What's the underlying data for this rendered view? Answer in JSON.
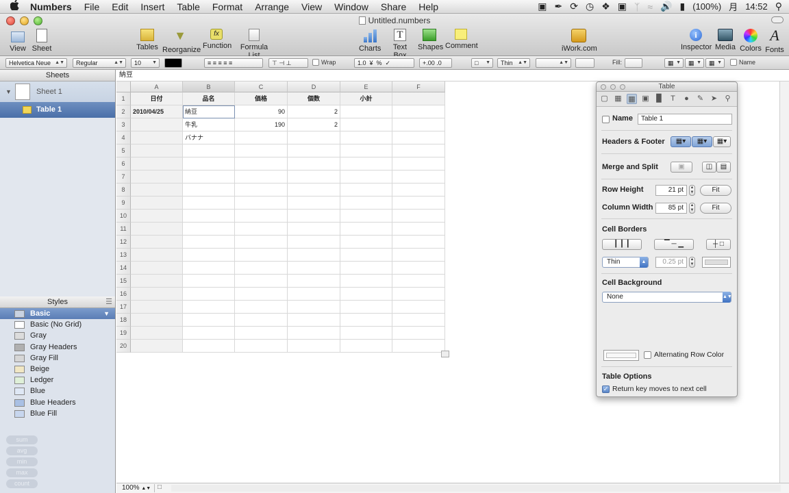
{
  "menubar": {
    "apple": "",
    "app": "Numbers",
    "items": [
      "File",
      "Edit",
      "Insert",
      "Table",
      "Format",
      "Arrange",
      "View",
      "Window",
      "Share",
      "Help"
    ],
    "battery": "(100%)",
    "day": "月",
    "time": "14:52"
  },
  "window": {
    "title": "Untitled.numbers"
  },
  "toolbar": {
    "view": "View",
    "sheet": "Sheet",
    "tables": "Tables",
    "reorganize": "Reorganize",
    "function": "Function",
    "formula_list": "Formula List",
    "charts": "Charts",
    "text_box": "Text Box",
    "shapes": "Shapes",
    "comment": "Comment",
    "iwork": "iWork.com",
    "inspector": "Inspector",
    "media": "Media",
    "colors": "Colors",
    "fonts": "Fonts"
  },
  "formatbar": {
    "font": "Helvetica Neue",
    "style": "Regular",
    "size": "10",
    "wrap": "Wrap",
    "decimals_add": "+.00",
    "decimals_remove": ".0",
    "border_weight": "Thin",
    "fill": "Fill:",
    "name": "Name"
  },
  "formula": {
    "value": "納豆"
  },
  "sheets_panel": {
    "header": "Sheets",
    "sheet": "Sheet 1",
    "table": "Table 1"
  },
  "styles_panel": {
    "header": "Styles",
    "items": [
      "Basic",
      "Basic (No Grid)",
      "Gray",
      "Gray Headers",
      "Gray Fill",
      "Beige",
      "Ledger",
      "Blue",
      "Blue Headers",
      "Blue Fill"
    ],
    "quick": [
      "sum",
      "avg",
      "min",
      "max",
      "count"
    ]
  },
  "table": {
    "columns": [
      "A",
      "B",
      "C",
      "D",
      "E",
      "F"
    ],
    "header_row": [
      "日付",
      "品名",
      "価格",
      "個数",
      "小計",
      ""
    ],
    "rows": [
      [
        "2010/04/25",
        "納豆",
        "90",
        "2",
        "",
        ""
      ],
      [
        "",
        "牛乳",
        "190",
        "2",
        "",
        ""
      ],
      [
        "",
        "バナナ",
        "",
        "",
        "",
        ""
      ]
    ],
    "row_numbers": [
      "1",
      "2",
      "3",
      "4",
      "5",
      "6",
      "7",
      "8",
      "9",
      "10",
      "11",
      "12",
      "13",
      "14",
      "15",
      "16",
      "17",
      "18",
      "19",
      "20"
    ]
  },
  "status": {
    "zoom": "100%"
  },
  "inspector": {
    "title": "Table",
    "name_label": "Name",
    "name_value": "Table 1",
    "headers_footer": "Headers & Footer",
    "merge_split": "Merge and Split",
    "row_height": "Row Height",
    "row_height_value": "21 pt",
    "column_width": "Column Width",
    "column_width_value": "85 pt",
    "fit": "Fit",
    "cell_borders": "Cell Borders",
    "border_style": "Thin",
    "border_width": "0.25 pt",
    "cell_background": "Cell Background",
    "background_value": "None",
    "alternating": "Alternating Row Color",
    "table_options": "Table Options",
    "return_key": "Return key moves to next cell"
  }
}
